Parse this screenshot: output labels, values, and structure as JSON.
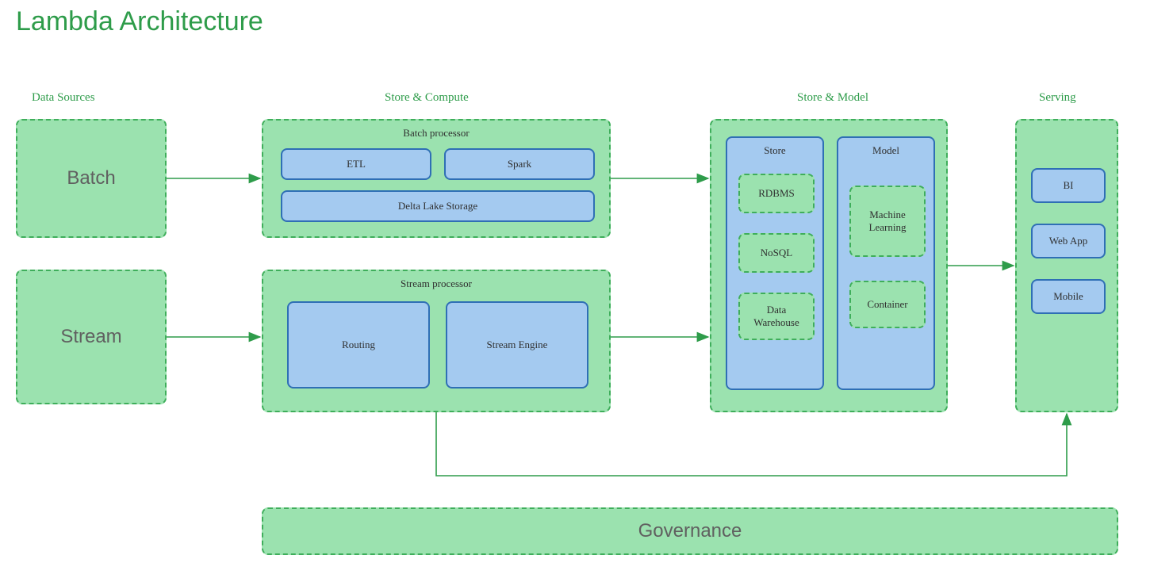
{
  "title": "Lambda Architecture",
  "columns": {
    "data_sources": "Data Sources",
    "store_compute": "Store & Compute",
    "store_model": "Store & Model",
    "serving": "Serving"
  },
  "sources": {
    "batch": "Batch",
    "stream": "Stream"
  },
  "compute": {
    "batch_processor": {
      "title": "Batch processor",
      "etl": "ETL",
      "spark": "Spark",
      "delta": "Delta Lake Storage"
    },
    "stream_processor": {
      "title": "Stream processor",
      "routing": "Routing",
      "stream_engine": "Stream Engine"
    }
  },
  "store_model": {
    "store": {
      "title": "Store",
      "rdbms": "RDBMS",
      "nosql": "NoSQL",
      "data_warehouse": "Data\nWarehouse"
    },
    "model": {
      "title": "Model",
      "ml": "Machine\nLearning",
      "container": "Container"
    }
  },
  "serving": {
    "bi": "BI",
    "web_app": "Web App",
    "mobile": "Mobile"
  },
  "governance": "Governance",
  "colors": {
    "accent_green": "#2E9C4A",
    "box_green_fill": "#9be2af",
    "box_green_stroke": "#3fae5b",
    "box_blue_fill": "#a4caf0",
    "box_blue_stroke": "#2f6fb5",
    "label_gray": "#606060"
  },
  "connections": [
    {
      "from": "source-batch",
      "to": "batch-processor",
      "style": "straight"
    },
    {
      "from": "source-stream",
      "to": "stream-processor",
      "style": "straight"
    },
    {
      "from": "batch-processor",
      "to": "store-model-group",
      "style": "straight"
    },
    {
      "from": "stream-processor",
      "to": "store-model-group",
      "style": "straight"
    },
    {
      "from": "store-model-group",
      "to": "serving-group",
      "style": "straight"
    },
    {
      "from": "stream-processor",
      "to": "serving-group",
      "style": "elbow-down"
    }
  ]
}
